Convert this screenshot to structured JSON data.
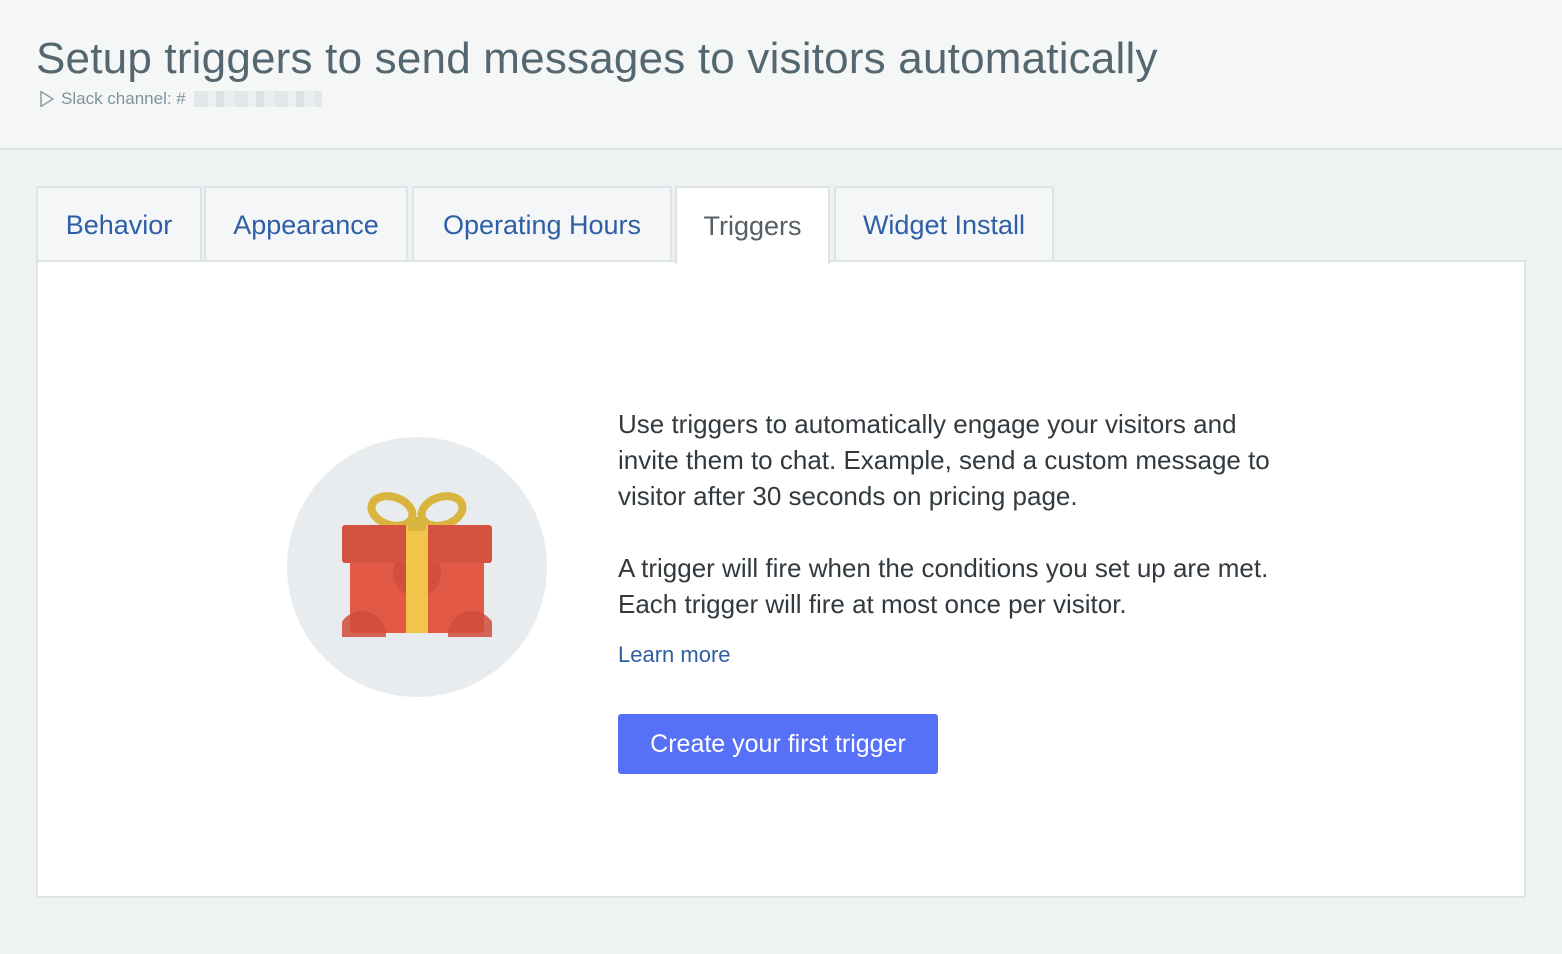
{
  "header": {
    "title": "Setup triggers to send messages to visitors automatically",
    "channel_label": "Slack channel: #",
    "channel_icon": "play-outline-icon"
  },
  "tabs": [
    {
      "label": "Behavior",
      "active": false
    },
    {
      "label": "Appearance",
      "active": false
    },
    {
      "label": "Operating Hours",
      "active": false
    },
    {
      "label": "Triggers",
      "active": true
    },
    {
      "label": "Widget Install",
      "active": false
    }
  ],
  "empty_state": {
    "illustration": "gift-icon",
    "paragraph_1": "Use triggers to automatically engage your visitors and invite them to chat. Example, send a custom message to visitor after 30 seconds on pricing page.",
    "paragraph_2": "A trigger will fire when the conditions you set up are met. Each trigger will fire at most once per visitor.",
    "learn_more": "Learn more",
    "cta_label": "Create your first trigger"
  },
  "colors": {
    "accent_button": "#5670f7",
    "link": "#2e5fa6",
    "gift_red": "#e25a45",
    "gift_ribbon": "#f2c54a",
    "gift_bow": "#d9b43f"
  }
}
